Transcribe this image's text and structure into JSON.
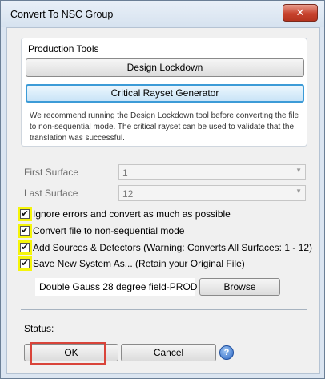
{
  "window": {
    "title": "Convert To NSC Group",
    "close_glyph": "✕"
  },
  "production_tools": {
    "label": "Production Tools",
    "design_lockdown_label": "Design Lockdown",
    "critical_rayset_label": "Critical Rayset Generator",
    "note": "We recommend running the Design Lockdown tool before converting the file to non-sequential mode. The critical rayset can be used to validate that the translation was successful."
  },
  "first_surface": {
    "label": "First Surface",
    "value": "1"
  },
  "last_surface": {
    "label": "Last Surface",
    "value": "12"
  },
  "options": [
    {
      "label": "Ignore errors and convert as much as possible",
      "checked": true
    },
    {
      "label": "Convert file to non-sequential mode",
      "checked": true
    },
    {
      "label": "Add Sources & Detectors (Warning: Converts All Surfaces: 1 - 12)",
      "checked": true
    },
    {
      "label": "Save New System As... (Retain your Original File)",
      "checked": true
    }
  ],
  "check_glyph": "✔",
  "save_as": {
    "filename": "Double Gauss 28 degree field-PROD",
    "browse_label": "Browse"
  },
  "status": {
    "label": "Status:"
  },
  "footer": {
    "ok_label": "OK",
    "cancel_label": "Cancel",
    "help_glyph": "?"
  },
  "colors": {
    "highlight_yellow": "#f5f50a",
    "ok_highlight_border": "#d9443a",
    "focus_blue": "#3c9bd7"
  }
}
